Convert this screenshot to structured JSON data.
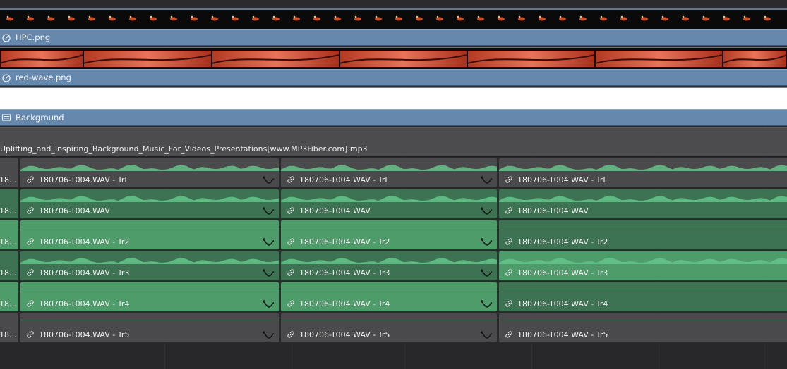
{
  "timeline": {
    "video_tracks": [
      {
        "name": "HPC.png",
        "icon": "clip-icon"
      },
      {
        "name": "red-wave.png",
        "icon": "clip-icon"
      },
      {
        "name": "Background",
        "icon": "generator-icon"
      }
    ],
    "music_clip": {
      "name": "Uplifting_and_Inspiring_Background_Music_For_Videos_Presentations[www.MP3Fiber.com].mp3"
    },
    "audio_tracks": [
      {
        "stub": "18...",
        "clips": [
          "180706-T004.WAV - TrL",
          "180706-T004.WAV - TrL",
          "180706-T004.WAV - TrL"
        ]
      },
      {
        "stub": "18...",
        "clips": [
          "180706-T004.WAV",
          "180706-T004.WAV",
          "180706-T004.WAV"
        ]
      },
      {
        "stub": "18...",
        "clips": [
          "180706-T004.WAV - Tr2",
          "180706-T004.WAV - Tr2",
          "180706-T004.WAV - Tr2"
        ]
      },
      {
        "stub": "18...",
        "clips": [
          "180706-T004.WAV - Tr3",
          "180706-T004.WAV - Tr3",
          "180706-T004.WAV - Tr3"
        ]
      },
      {
        "stub": "18...",
        "clips": [
          "180706-T004.WAV - Tr4",
          "180706-T004.WAV - Tr4",
          "180706-T004.WAV - Tr4"
        ]
      },
      {
        "stub": "18...",
        "clips": [
          "180706-T004.WAV - Tr5",
          "180706-T004.WAV - Tr5",
          "180706-T004.WAV - Tr5"
        ]
      }
    ]
  },
  "colors": {
    "video_header": "#6688ad",
    "audio_clip": "#4f9c6b",
    "audio_clip_dark": "#3d7252",
    "timeline_bg": "#28282b"
  }
}
